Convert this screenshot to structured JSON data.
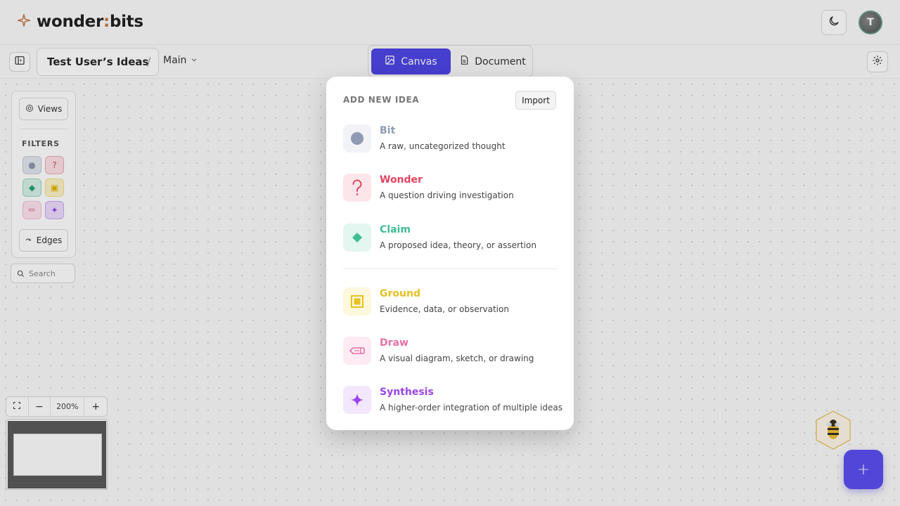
{
  "brand": {
    "name_part1": "wonder",
    "name_colon": ":",
    "name_part2": "bits",
    "logo_icon": "sparkle-icon"
  },
  "header": {
    "theme_toggle_icon": "moon-icon",
    "avatar_initial": "T"
  },
  "subbar": {
    "project_name": "Test User’s Ideas",
    "separator": "/",
    "branch": "Main",
    "tabs": [
      {
        "label": "Canvas",
        "icon": "image-icon",
        "active": true
      },
      {
        "label": "Document",
        "icon": "document-icon",
        "active": false
      }
    ]
  },
  "panel": {
    "views_label": "Views",
    "filters_label": "FILTERS",
    "edges_label": "Edges",
    "filter_chips": [
      {
        "name": "bit",
        "glyph": "●",
        "color": "#8a98b0",
        "bg": "#e2e6ee"
      },
      {
        "name": "wonder",
        "glyph": "?",
        "color": "#d94360",
        "bg": "#fbe0e5"
      },
      {
        "name": "claim",
        "glyph": "◆",
        "color": "#2aa37a",
        "bg": "#d7f1e6"
      },
      {
        "name": "ground",
        "glyph": "▣",
        "color": "#e0b400",
        "bg": "#fdf3c8"
      },
      {
        "name": "draw",
        "glyph": "✏",
        "color": "#e474aa",
        "bg": "#fde4ef"
      },
      {
        "name": "synthesis",
        "glyph": "✦",
        "color": "#9140e8",
        "bg": "#ecdcfd"
      }
    ]
  },
  "search": {
    "placeholder": "Search"
  },
  "zoom": {
    "level": "200%",
    "minus": "−",
    "plus": "+"
  },
  "fab": {
    "label": "+"
  },
  "modal": {
    "title": "ADD NEW IDEA",
    "import_label": "Import",
    "options": [
      {
        "title": "Bit",
        "desc": "A raw, uncategorized thought",
        "color": "#8f9bb3",
        "bg": "#f1f3f6",
        "icon": "circle-icon"
      },
      {
        "title": "Wonder",
        "desc": "A question driving investigation",
        "color": "#e0445f",
        "bg": "#fde6ea",
        "icon": "question-icon"
      },
      {
        "title": "Claim",
        "desc": "A proposed idea, theory, or assertion",
        "color": "#3fbd93",
        "bg": "#e3f6ef",
        "icon": "diamond-icon"
      },
      {
        "title": "Ground",
        "desc": "Evidence, data, or observation",
        "color": "#e8c020",
        "bg": "#fff8dc",
        "icon": "square-icon"
      },
      {
        "title": "Draw",
        "desc": "A visual diagram, sketch, or drawing",
        "color": "#e570a8",
        "bg": "#fdeaf3",
        "icon": "pencil-icon"
      },
      {
        "title": "Synthesis",
        "desc": "A higher-order integration of multiple ideas",
        "color": "#9b45ea",
        "bg": "#f3e7fd",
        "icon": "sparkle-icon"
      }
    ]
  }
}
